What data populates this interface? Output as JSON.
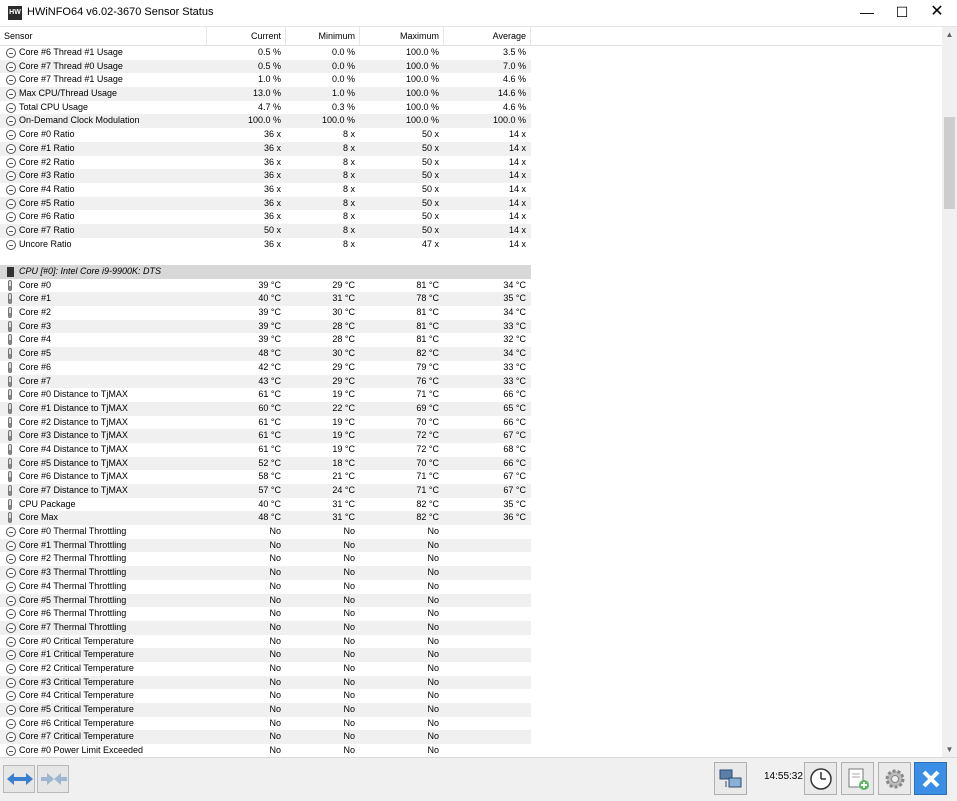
{
  "window": {
    "title": "HWiNFO64 v6.02-3670 Sensor Status",
    "minimize_glyph": "—",
    "maximize_glyph": "☐",
    "close_glyph": "✕",
    "app_icon_text": "HW"
  },
  "columns": [
    "Sensor",
    "Current",
    "Minimum",
    "Maximum",
    "Average"
  ],
  "section1_rows": [
    {
      "icon": "usage",
      "name": "Core #6 Thread #1 Usage",
      "cur": "0.5 %",
      "min": "0.0 %",
      "max": "100.0 %",
      "avg": "3.5 %"
    },
    {
      "icon": "usage",
      "name": "Core #7 Thread #0 Usage",
      "cur": "0.5 %",
      "min": "0.0 %",
      "max": "100.0 %",
      "avg": "7.0 %"
    },
    {
      "icon": "usage",
      "name": "Core #7 Thread #1 Usage",
      "cur": "1.0 %",
      "min": "0.0 %",
      "max": "100.0 %",
      "avg": "4.6 %"
    },
    {
      "icon": "usage",
      "name": "Max CPU/Thread Usage",
      "cur": "13.0 %",
      "min": "1.0 %",
      "max": "100.0 %",
      "avg": "14.6 %"
    },
    {
      "icon": "usage",
      "name": "Total CPU Usage",
      "cur": "4.7 %",
      "min": "0.3 %",
      "max": "100.0 %",
      "avg": "4.6 %"
    },
    {
      "icon": "usage",
      "name": "On-Demand Clock Modulation",
      "cur": "100.0 %",
      "min": "100.0 %",
      "max": "100.0 %",
      "avg": "100.0 %"
    },
    {
      "icon": "usage",
      "name": "Core #0 Ratio",
      "cur": "36 x",
      "min": "8 x",
      "max": "50 x",
      "avg": "14 x"
    },
    {
      "icon": "usage",
      "name": "Core #1 Ratio",
      "cur": "36 x",
      "min": "8 x",
      "max": "50 x",
      "avg": "14 x"
    },
    {
      "icon": "usage",
      "name": "Core #2 Ratio",
      "cur": "36 x",
      "min": "8 x",
      "max": "50 x",
      "avg": "14 x"
    },
    {
      "icon": "usage",
      "name": "Core #3 Ratio",
      "cur": "36 x",
      "min": "8 x",
      "max": "50 x",
      "avg": "14 x"
    },
    {
      "icon": "usage",
      "name": "Core #4 Ratio",
      "cur": "36 x",
      "min": "8 x",
      "max": "50 x",
      "avg": "14 x"
    },
    {
      "icon": "usage",
      "name": "Core #5 Ratio",
      "cur": "36 x",
      "min": "8 x",
      "max": "50 x",
      "avg": "14 x"
    },
    {
      "icon": "usage",
      "name": "Core #6 Ratio",
      "cur": "36 x",
      "min": "8 x",
      "max": "50 x",
      "avg": "14 x"
    },
    {
      "icon": "usage",
      "name": "Core #7 Ratio",
      "cur": "50 x",
      "min": "8 x",
      "max": "50 x",
      "avg": "14 x"
    },
    {
      "icon": "usage",
      "name": "Uncore Ratio",
      "cur": "36 x",
      "min": "8 x",
      "max": "47 x",
      "avg": "14 x"
    }
  ],
  "group": {
    "label": "CPU [#0]: Intel Core i9-9900K: DTS"
  },
  "section2_rows": [
    {
      "icon": "temp",
      "name": "Core #0",
      "cur": "39 °C",
      "min": "29 °C",
      "max": "81 °C",
      "avg": "34 °C"
    },
    {
      "icon": "temp",
      "name": "Core #1",
      "cur": "40 °C",
      "min": "31 °C",
      "max": "78 °C",
      "avg": "35 °C"
    },
    {
      "icon": "temp",
      "name": "Core #2",
      "cur": "39 °C",
      "min": "30 °C",
      "max": "81 °C",
      "avg": "34 °C"
    },
    {
      "icon": "temp",
      "name": "Core #3",
      "cur": "39 °C",
      "min": "28 °C",
      "max": "81 °C",
      "avg": "33 °C"
    },
    {
      "icon": "temp",
      "name": "Core #4",
      "cur": "39 °C",
      "min": "28 °C",
      "max": "81 °C",
      "avg": "32 °C"
    },
    {
      "icon": "temp",
      "name": "Core #5",
      "cur": "48 °C",
      "min": "30 °C",
      "max": "82 °C",
      "avg": "34 °C"
    },
    {
      "icon": "temp",
      "name": "Core #6",
      "cur": "42 °C",
      "min": "29 °C",
      "max": "79 °C",
      "avg": "33 °C"
    },
    {
      "icon": "temp",
      "name": "Core #7",
      "cur": "43 °C",
      "min": "29 °C",
      "max": "76 °C",
      "avg": "33 °C"
    },
    {
      "icon": "temp",
      "name": "Core #0 Distance to TjMAX",
      "cur": "61 °C",
      "min": "19 °C",
      "max": "71 °C",
      "avg": "66 °C"
    },
    {
      "icon": "temp",
      "name": "Core #1 Distance to TjMAX",
      "cur": "60 °C",
      "min": "22 °C",
      "max": "69 °C",
      "avg": "65 °C"
    },
    {
      "icon": "temp",
      "name": "Core #2 Distance to TjMAX",
      "cur": "61 °C",
      "min": "19 °C",
      "max": "70 °C",
      "avg": "66 °C"
    },
    {
      "icon": "temp",
      "name": "Core #3 Distance to TjMAX",
      "cur": "61 °C",
      "min": "19 °C",
      "max": "72 °C",
      "avg": "67 °C"
    },
    {
      "icon": "temp",
      "name": "Core #4 Distance to TjMAX",
      "cur": "61 °C",
      "min": "19 °C",
      "max": "72 °C",
      "avg": "68 °C"
    },
    {
      "icon": "temp",
      "name": "Core #5 Distance to TjMAX",
      "cur": "52 °C",
      "min": "18 °C",
      "max": "70 °C",
      "avg": "66 °C"
    },
    {
      "icon": "temp",
      "name": "Core #6 Distance to TjMAX",
      "cur": "58 °C",
      "min": "21 °C",
      "max": "71 °C",
      "avg": "67 °C"
    },
    {
      "icon": "temp",
      "name": "Core #7 Distance to TjMAX",
      "cur": "57 °C",
      "min": "24 °C",
      "max": "71 °C",
      "avg": "67 °C"
    },
    {
      "icon": "temp",
      "name": "CPU Package",
      "cur": "40 °C",
      "min": "31 °C",
      "max": "82 °C",
      "avg": "35 °C"
    },
    {
      "icon": "temp",
      "name": "Core Max",
      "cur": "48 °C",
      "min": "31 °C",
      "max": "82 °C",
      "avg": "36 °C"
    },
    {
      "icon": "usage",
      "name": "Core #0 Thermal Throttling",
      "cur": "No",
      "min": "No",
      "max": "No",
      "avg": ""
    },
    {
      "icon": "usage",
      "name": "Core #1 Thermal Throttling",
      "cur": "No",
      "min": "No",
      "max": "No",
      "avg": ""
    },
    {
      "icon": "usage",
      "name": "Core #2 Thermal Throttling",
      "cur": "No",
      "min": "No",
      "max": "No",
      "avg": ""
    },
    {
      "icon": "usage",
      "name": "Core #3 Thermal Throttling",
      "cur": "No",
      "min": "No",
      "max": "No",
      "avg": ""
    },
    {
      "icon": "usage",
      "name": "Core #4 Thermal Throttling",
      "cur": "No",
      "min": "No",
      "max": "No",
      "avg": ""
    },
    {
      "icon": "usage",
      "name": "Core #5 Thermal Throttling",
      "cur": "No",
      "min": "No",
      "max": "No",
      "avg": ""
    },
    {
      "icon": "usage",
      "name": "Core #6 Thermal Throttling",
      "cur": "No",
      "min": "No",
      "max": "No",
      "avg": ""
    },
    {
      "icon": "usage",
      "name": "Core #7 Thermal Throttling",
      "cur": "No",
      "min": "No",
      "max": "No",
      "avg": ""
    },
    {
      "icon": "usage",
      "name": "Core #0 Critical Temperature",
      "cur": "No",
      "min": "No",
      "max": "No",
      "avg": ""
    },
    {
      "icon": "usage",
      "name": "Core #1 Critical Temperature",
      "cur": "No",
      "min": "No",
      "max": "No",
      "avg": ""
    },
    {
      "icon": "usage",
      "name": "Core #2 Critical Temperature",
      "cur": "No",
      "min": "No",
      "max": "No",
      "avg": ""
    },
    {
      "icon": "usage",
      "name": "Core #3 Critical Temperature",
      "cur": "No",
      "min": "No",
      "max": "No",
      "avg": ""
    },
    {
      "icon": "usage",
      "name": "Core #4 Critical Temperature",
      "cur": "No",
      "min": "No",
      "max": "No",
      "avg": ""
    },
    {
      "icon": "usage",
      "name": "Core #5 Critical Temperature",
      "cur": "No",
      "min": "No",
      "max": "No",
      "avg": ""
    },
    {
      "icon": "usage",
      "name": "Core #6 Critical Temperature",
      "cur": "No",
      "min": "No",
      "max": "No",
      "avg": ""
    },
    {
      "icon": "usage",
      "name": "Core #7 Critical Temperature",
      "cur": "No",
      "min": "No",
      "max": "No",
      "avg": ""
    },
    {
      "icon": "usage",
      "name": "Core #0 Power Limit Exceeded",
      "cur": "No",
      "min": "No",
      "max": "No",
      "avg": ""
    }
  ],
  "toolbar": {
    "clock": "14:55:32",
    "icons": [
      "network-icon",
      "clock-icon",
      "add-report-icon",
      "settings-icon",
      "close-icon"
    ]
  },
  "colors": {
    "row_alt": "#f0f0f0",
    "group_bg": "#d8d8d8",
    "nav_arrow": "#3a7fd0",
    "close_btn": "#3a8ee6"
  }
}
